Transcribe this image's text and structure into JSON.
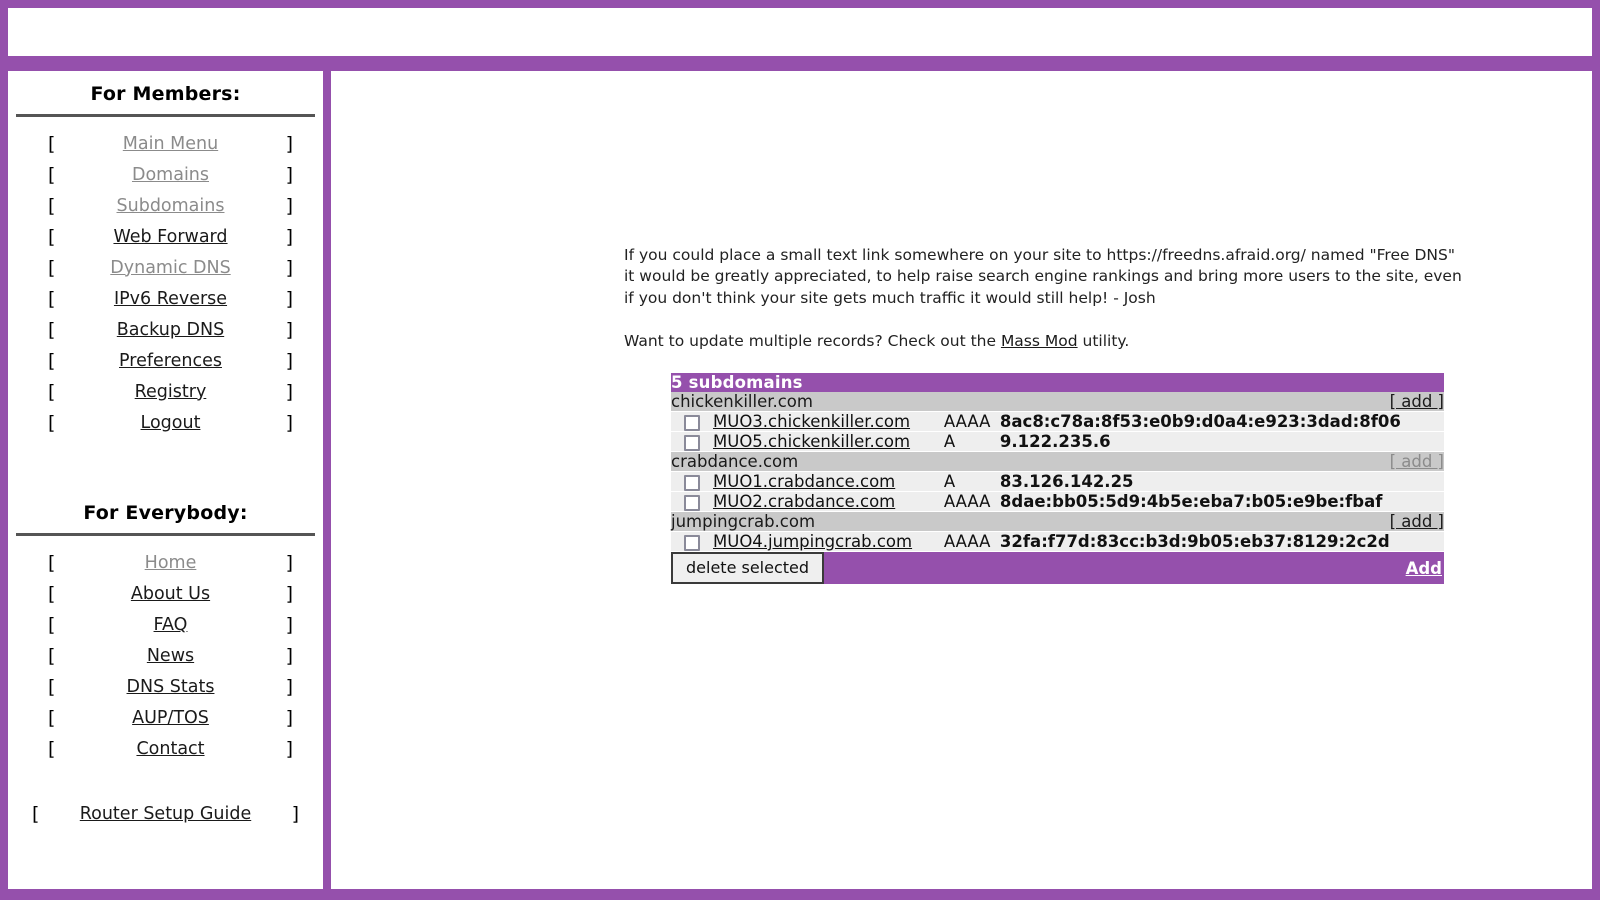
{
  "theme": {
    "frame_purple": "#9550ac",
    "header_purple": "#9550ac",
    "domain_row_gray": "#c9c9c9",
    "record_row_gray": "#eeeeee",
    "visited_link_gray": "#8b8b8b"
  },
  "sidebar": {
    "members_heading": "For Members:",
    "everybody_heading": "For Everybody:",
    "bracket_open": "[",
    "bracket_close": "]",
    "members_items": [
      {
        "label": "Main Menu",
        "state": "visited"
      },
      {
        "label": "Domains",
        "state": "visited"
      },
      {
        "label": "Subdomains",
        "state": "visited"
      },
      {
        "label": "Web Forward",
        "state": "normal"
      },
      {
        "label": "Dynamic DNS",
        "state": "visited"
      },
      {
        "label": "IPv6 Reverse",
        "state": "normal"
      },
      {
        "label": "Backup DNS",
        "state": "normal"
      },
      {
        "label": "Preferences",
        "state": "normal"
      },
      {
        "label": "Registry",
        "state": "normal"
      },
      {
        "label": "Logout",
        "state": "normal"
      }
    ],
    "everybody_items": [
      {
        "label": "Home",
        "state": "visited"
      },
      {
        "label": "About Us",
        "state": "normal"
      },
      {
        "label": "FAQ",
        "state": "normal"
      },
      {
        "label": "News",
        "state": "normal"
      },
      {
        "label": "DNS Stats",
        "state": "normal"
      },
      {
        "label": "AUP/TOS",
        "state": "normal"
      },
      {
        "label": "Contact",
        "state": "normal"
      }
    ],
    "router_item": {
      "label": "Router Setup Guide",
      "state": "normal"
    }
  },
  "content": {
    "notice": "If you could place a small text link somewhere on your site to https://freedns.afraid.org/ named \"Free DNS\" it would be greatly appreciated, to help raise search engine rankings and bring more users to the site, even if you don't think your site gets much traffic it would still help! - Josh",
    "massmod_prefix": "Want to update multiple records? Check out the ",
    "massmod_link": "Mass Mod",
    "massmod_suffix": " utility."
  },
  "table": {
    "title": "5 subdomains",
    "add_label": "[ add ]",
    "groups": [
      {
        "domain": "chickenkiller.com",
        "add_state": "normal",
        "records": [
          {
            "host": "MUO3.chickenkiller.com",
            "type": "AAAA",
            "value": "8ac8:c78a:8f53:e0b9:d0a4:e923:3dad:8f06",
            "checked": false
          },
          {
            "host": "MUO5.chickenkiller.com",
            "type": "A",
            "value": "9.122.235.6",
            "checked": false
          }
        ]
      },
      {
        "domain": "crabdance.com",
        "add_state": "muted",
        "records": [
          {
            "host": "MUO1.crabdance.com",
            "type": "A",
            "value": "83.126.142.25",
            "checked": false
          },
          {
            "host": "MUO2.crabdance.com",
            "type": "AAAA",
            "value": "8dae:bb05:5d9:4b5e:eba7:b05:e9be:fbaf",
            "checked": false
          }
        ]
      },
      {
        "domain": "jumpingcrab.com",
        "add_state": "normal",
        "records": [
          {
            "host": "MUO4.jumpingcrab.com",
            "type": "AAAA",
            "value": "32fa:f77d:83cc:b3d:9b05:eb37:8129:2c2d",
            "checked": false
          }
        ]
      }
    ],
    "delete_button": "delete selected",
    "add_link": "Add"
  }
}
